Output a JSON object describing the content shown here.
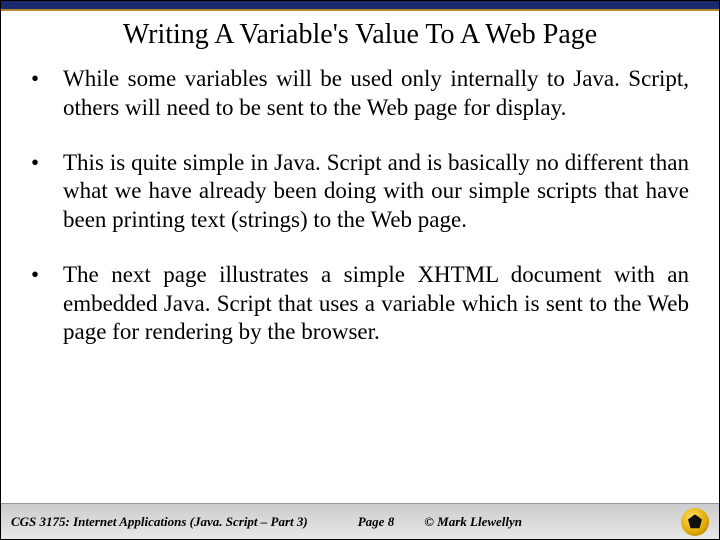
{
  "title": "Writing A Variable's Value To A Web Page",
  "bullets": [
    "While some variables will be used only internally to Java. Script, others will need to be sent to the Web page for display.",
    "This is quite simple in Java. Script and is basically no different than what we have already been doing with our simple scripts that have been printing text (strings) to the Web page.",
    "The next page illustrates a simple XHTML document with an embedded Java. Script that uses a variable which is sent to the Web page for rendering by the browser."
  ],
  "footer": {
    "course": "CGS 3175: Internet Applications (Java. Script – Part 3)",
    "page": "Page 8",
    "author": "© Mark Llewellyn"
  }
}
